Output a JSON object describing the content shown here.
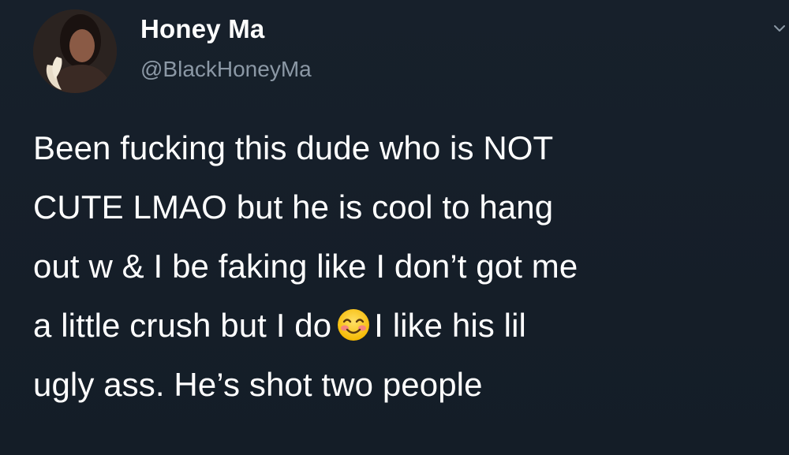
{
  "user": {
    "display_name": "Honey Ma",
    "handle": "@BlackHoneyMa",
    "avatar_icon": "profile-photo"
  },
  "menu": {
    "icon": "chevron-down-icon"
  },
  "tweet": {
    "line_1": "Been fucking this dude who is NOT",
    "line_2": "CUTE LMAO but he is cool to hang",
    "line_3": "out w & I be faking like I don’t got me",
    "line_4_before_emoji": "a little crush but I do",
    "emoji_icon": "smiling-face-with-smiling-eyes-emoji",
    "line_4_after_emoji": "I like his lil",
    "line_5": "ugly ass. He’s shot two people"
  },
  "colors": {
    "background": "#15202b",
    "text": "#ffffff",
    "secondary_text": "#8b98a5"
  }
}
